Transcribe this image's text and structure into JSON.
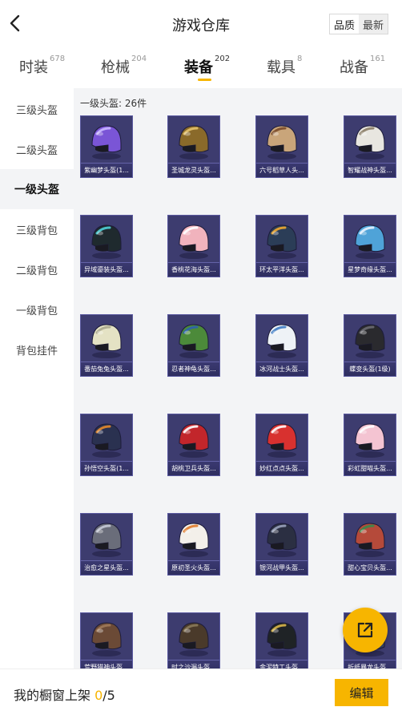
{
  "header": {
    "title": "游戏仓库",
    "sort_options": [
      "品质",
      "最新"
    ],
    "sort_selected": "品质"
  },
  "tabs": [
    {
      "label": "时装",
      "count": "678"
    },
    {
      "label": "枪械",
      "count": "204"
    },
    {
      "label": "装备",
      "count": "202",
      "active": true
    },
    {
      "label": "载具",
      "count": "8"
    },
    {
      "label": "战备",
      "count": "161"
    }
  ],
  "sidebar": {
    "items": [
      {
        "label": "三级头盔"
      },
      {
        "label": "二级头盔"
      },
      {
        "label": "一级头盔",
        "active": true
      },
      {
        "label": "三级背包"
      },
      {
        "label": "二级背包"
      },
      {
        "label": "一级背包"
      },
      {
        "label": "背包挂件"
      }
    ]
  },
  "section": {
    "label": "一级头盔: 26件"
  },
  "items": [
    {
      "name": "紫幽梦头盔(1...",
      "helmet": "#7a55d6",
      "trim": "#c9b8ff"
    },
    {
      "name": "圣城龙灵头盔...",
      "helmet": "#8a6a2a",
      "trim": "#e4c36b"
    },
    {
      "name": "六号稻草人头...",
      "helmet": "#c9a57a",
      "trim": "#7a4b2a"
    },
    {
      "name": "智耀战神头盔...",
      "helmet": "#e8e6e0",
      "trim": "#8a7c66"
    },
    {
      "name": "异域鎏装头盔...",
      "helmet": "#1f2a2e",
      "trim": "#4fd2d8"
    },
    {
      "name": "香桃花海头盔...",
      "helmet": "#f1b3bd",
      "trim": "#ffffff"
    },
    {
      "name": "环太平洋头盔...",
      "helmet": "#2b3d57",
      "trim": "#f0a830"
    },
    {
      "name": "星梦奇缘头盔...",
      "helmet": "#4fa3d8",
      "trim": "#e7f3ff"
    },
    {
      "name": "番茄兔兔头盔...",
      "helmet": "#e4e2c4",
      "trim": "#a9a78c"
    },
    {
      "name": "忍者神龟头盔...",
      "helmet": "#4c8a3a",
      "trim": "#2c5fb0"
    },
    {
      "name": "冰河战士头盔...",
      "helmet": "#eef2f6",
      "trim": "#3e7cc4"
    },
    {
      "name": "蝶变头盔(1级)",
      "helmet": "#2a2a2e",
      "trim": "#6a6a72"
    },
    {
      "name": "孙悟空头盔(1...",
      "helmet": "#2a3150",
      "trim": "#e58a2b"
    },
    {
      "name": "胡桃卫兵头盔...",
      "helmet": "#c2262b",
      "trim": "#ffffff"
    },
    {
      "name": "妙红点点头盔...",
      "helmet": "#d8312f",
      "trim": "#ffffff"
    },
    {
      "name": "彩虹甜喵头盔...",
      "helmet": "#f4c4d2",
      "trim": "#ffffff"
    },
    {
      "name": "治愈之星头盔...",
      "helmet": "#6a6d7a",
      "trim": "#c5c9d6"
    },
    {
      "name": "原初圣火头盔...",
      "helmet": "#f3f0ea",
      "trim": "#e07a2a"
    },
    {
      "name": "银河战甲头盔...",
      "helmet": "#2b2f42",
      "trim": "#9aa3bd"
    },
    {
      "name": "甜心宝贝头盔...",
      "helmet": "#b54a3a",
      "trim": "#3a8a4a"
    },
    {
      "name": "荒野猎神头盔...",
      "helmet": "#6b4a36",
      "trim": "#a07a5a"
    },
    {
      "name": "时之沙漏头盔...",
      "helmet": "#4a3a2a",
      "trim": "#8a7a5a"
    },
    {
      "name": "金泥特工头盔...",
      "helmet": "#1f2326",
      "trim": "#d9b64a"
    },
    {
      "name": "折纸暴龙头盔...",
      "helmet": "#3a4a6a",
      "trim": "#8a9abf"
    }
  ],
  "fab": {
    "icon": "share-icon"
  },
  "bottom_bar": {
    "label": "我的橱窗上架 ",
    "count_current": "0",
    "count_total": "/5",
    "edit_label": "编辑"
  },
  "colors": {
    "accent": "#f7b500",
    "card_bg": "#3d3c6f",
    "content_bg": "#f3f4f6"
  }
}
